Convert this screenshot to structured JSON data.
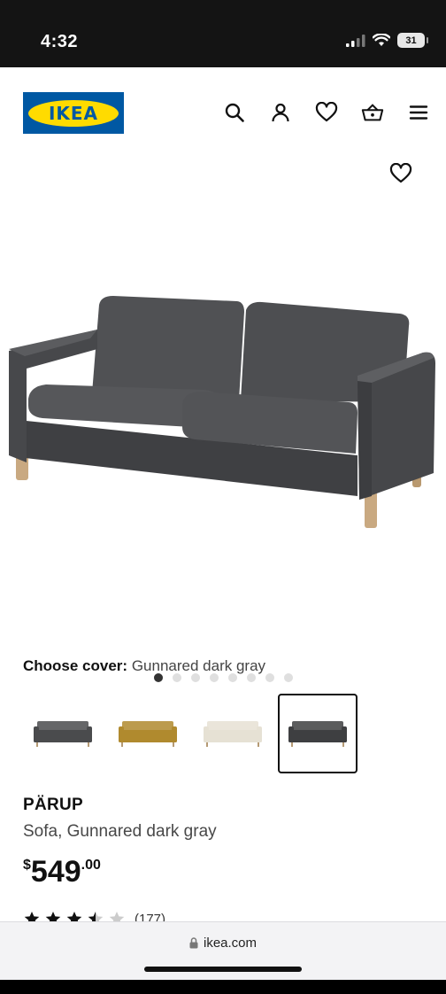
{
  "status": {
    "time": "4:32",
    "battery": "31"
  },
  "header": {
    "logo_text": "IKEA",
    "icons": [
      "search-icon",
      "account-icon",
      "heart-icon",
      "basket-icon",
      "menu-icon"
    ]
  },
  "hero": {
    "image_alt": "sofa-image",
    "dot_count": 8,
    "active_dot": 0
  },
  "cover": {
    "label": "Choose cover:",
    "value": "Gunnared dark gray"
  },
  "swatches": [
    {
      "name": "swatch-dark-gray",
      "color": "#4a4b4d",
      "selected": false
    },
    {
      "name": "swatch-golden-yellow",
      "color": "#b08a2e",
      "selected": false
    },
    {
      "name": "swatch-beige",
      "color": "#e6e1d4",
      "selected": false
    },
    {
      "name": "swatch-gunnared-dark-gray",
      "color": "#3e3f41",
      "selected": true
    }
  ],
  "product": {
    "name": "PÄRUP",
    "description": "Sofa, Gunnared dark gray",
    "currency": "$",
    "price_int": "549",
    "price_dec": ".00",
    "rating_stars": 3.5,
    "review_count": "(177)"
  },
  "browser": {
    "url": "ikea.com"
  },
  "colors": {
    "ikea_blue": "#0058a3",
    "ikea_yellow": "#ffdb00",
    "sofa": "#4b4c4f"
  }
}
